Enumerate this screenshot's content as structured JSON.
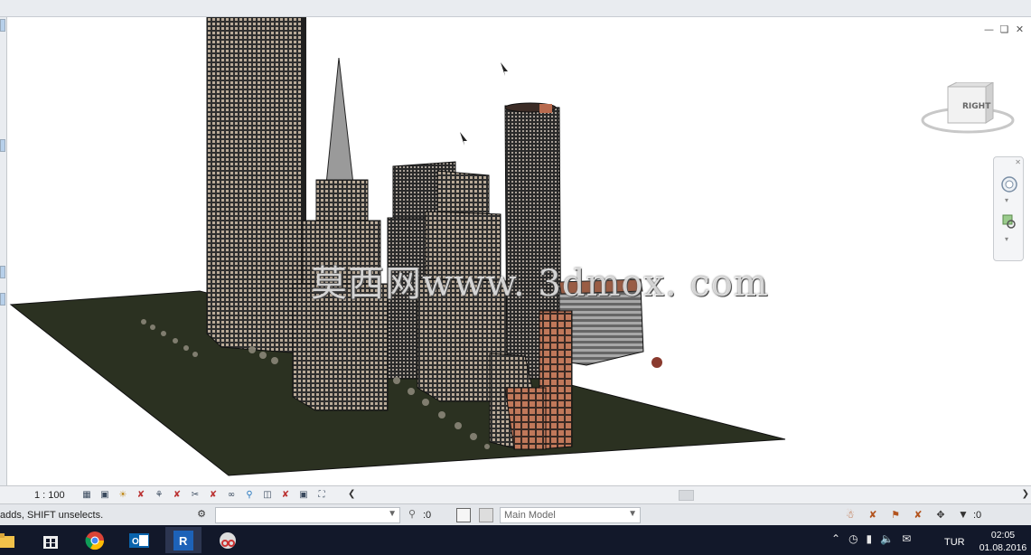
{
  "viewport": {
    "watermark": "莫西网www. 3dmox. com",
    "viewcube_label": "RIGHT",
    "window_controls": [
      "minimize-icon",
      "restore-icon",
      "close-icon"
    ]
  },
  "view_control_bar": {
    "scale": "1 : 100",
    "icons": [
      "detail-level-icon",
      "visual-style-icon",
      "sun-path-icon",
      "shadows-icon",
      "rendering-icon",
      "crop-view-icon",
      "show-crop-icon",
      "unlock-3d-icon",
      "temporary-hide-icon",
      "reveal-hidden-icon",
      "analytical-model-icon",
      "highlight-displacement-icon",
      "reveal-constraints-icon"
    ]
  },
  "status_bar": {
    "message": "adds, SHIFT unselects.",
    "editable_count": ":0",
    "active_model": "Main Model",
    "filter_count": ":0"
  },
  "taskbar": {
    "apps": [
      "file-explorer-icon",
      "store-icon",
      "chrome-icon",
      "outlook-icon",
      "revit-icon",
      "snipping-tool-icon"
    ],
    "language": "TUR",
    "time": "02:05",
    "date": "01.08.2016"
  },
  "colors": {
    "ground": "#2c3322",
    "building_dark": "#3a3a3a",
    "brick": "#b86a4e",
    "window_grid": "#d6c0a8",
    "taskbar": "#12182a",
    "accent": "#b7d0ea"
  }
}
